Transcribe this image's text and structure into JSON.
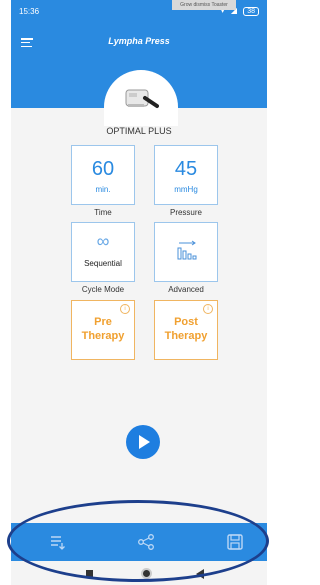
{
  "status": {
    "time": "15:36",
    "battery": "38"
  },
  "toast": "Grow dismiss Toaster",
  "app": {
    "logo": "Lympha Press"
  },
  "device": {
    "name": "OPTIMAL PLUS"
  },
  "tiles": {
    "time": {
      "value": "60",
      "unit": "min.",
      "label": "Time"
    },
    "pressure": {
      "value": "45",
      "unit": "mmHg",
      "label": "Pressure"
    },
    "cycle_mode": {
      "symbol": "∞",
      "value": "Sequential",
      "label": "Cycle Mode"
    },
    "advanced": {
      "label": "Advanced"
    },
    "pre_therapy": {
      "line1": "Pre",
      "line2": "Therapy"
    },
    "post_therapy": {
      "line1": "Post",
      "line2": "Therapy"
    }
  },
  "icons": {
    "menu": "menu-icon",
    "play": "play-icon",
    "list": "list-icon",
    "share": "share-icon",
    "save": "save-icon"
  },
  "colors": {
    "primary": "#2a8ae0",
    "accent": "#f0a030",
    "background": "#f4f4f4",
    "annotation": "#1d3f8c"
  }
}
